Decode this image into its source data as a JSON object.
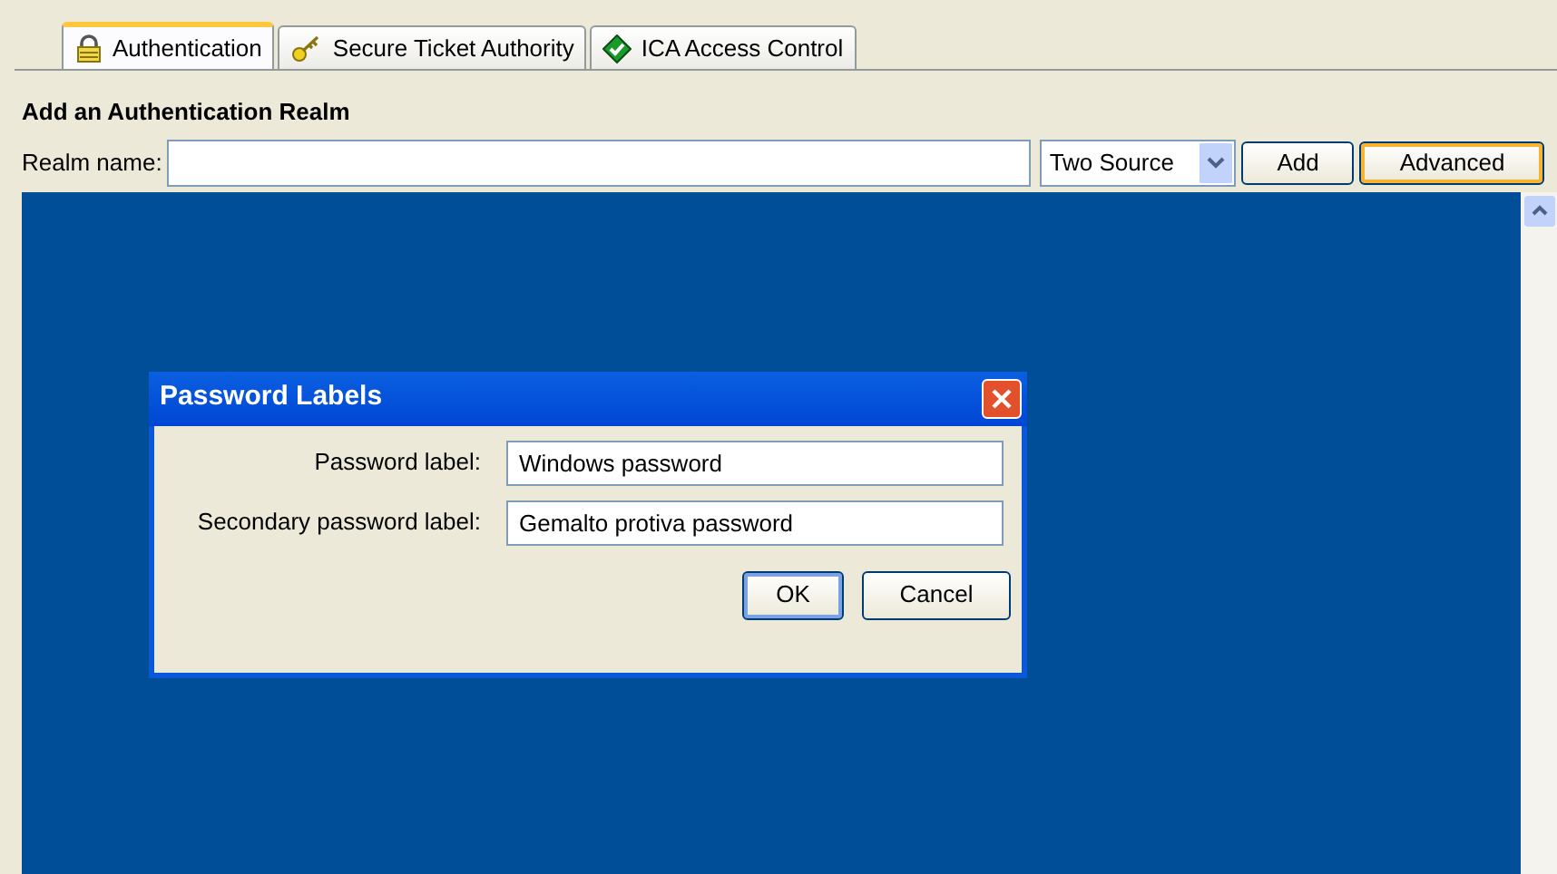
{
  "tabs": [
    {
      "label": "Authentication",
      "selected": true
    },
    {
      "label": "Secure Ticket Authority",
      "selected": false
    },
    {
      "label": "ICA Access Control",
      "selected": false
    }
  ],
  "section_title": "Add an Authentication Realm",
  "realm": {
    "label": "Realm name:",
    "source": "Two Source",
    "buttons": [
      {
        "label": "Add",
        "focused": false
      },
      {
        "label": "Advanced",
        "focused": true
      }
    ]
  },
  "dialog": {
    "title": "Password Labels",
    "fields": [
      {
        "label": "Password label:",
        "value": "Windows password"
      },
      {
        "label": "Secondary password label:",
        "value": "Gemalto protiva password"
      }
    ],
    "buttons": [
      {
        "label": "OK",
        "default": true
      },
      {
        "label": "Cancel",
        "default": false
      }
    ]
  }
}
